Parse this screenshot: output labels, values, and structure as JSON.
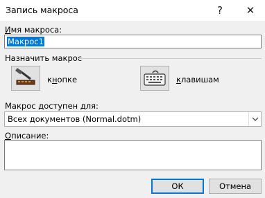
{
  "window": {
    "title": "Запись макроса",
    "help_label": "?",
    "close_label": "✕"
  },
  "macro_name": {
    "label_accel": "И",
    "label_rest": "мя макроса:",
    "value": "Макрос1"
  },
  "assign": {
    "group_label": "Назначить макрос",
    "button_label_pre": "к",
    "button_label_accel": "н",
    "button_label_post": "опке",
    "keyboard_label_accel": "к",
    "keyboard_label_rest": "лавишам"
  },
  "store": {
    "label_pre": "Макрос ",
    "label_accel": "д",
    "label_post": "оступен для:",
    "selected": "Всех документов (Normal.dotm)"
  },
  "description": {
    "label_accel": "О",
    "label_rest": "писание:",
    "value": ""
  },
  "buttons": {
    "ok": "ОК",
    "cancel": "Отмена"
  }
}
